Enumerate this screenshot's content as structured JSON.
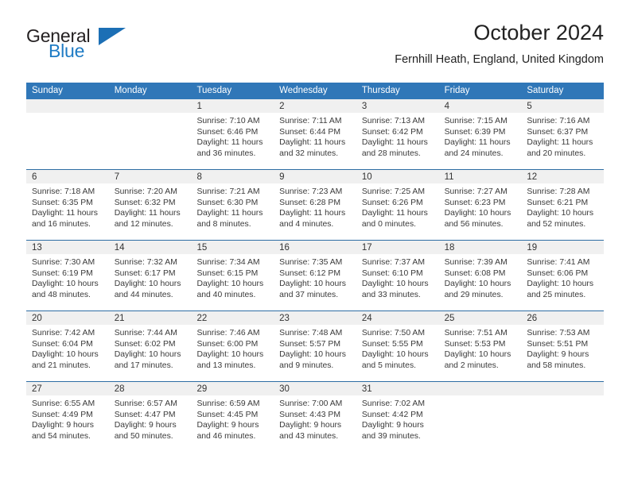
{
  "brand": {
    "name_top": "General",
    "name_bottom": "Blue",
    "triangle_color": "#1c6fb5",
    "blue_color": "#1e7bc4"
  },
  "header": {
    "title": "October 2024",
    "location": "Fernhill Heath, England, United Kingdom"
  },
  "theme": {
    "header_row_color": "#3077b8",
    "week_separator_color": "#2e6da4",
    "date_band_color": "#f0f0f0"
  },
  "weekdays": [
    "Sunday",
    "Monday",
    "Tuesday",
    "Wednesday",
    "Thursday",
    "Friday",
    "Saturday"
  ],
  "weeks": [
    [
      {
        "day": "",
        "sunrise": "",
        "sunset": "",
        "daylight1": "",
        "daylight2": "",
        "empty": true
      },
      {
        "day": "",
        "sunrise": "",
        "sunset": "",
        "daylight1": "",
        "daylight2": "",
        "empty": true
      },
      {
        "day": "1",
        "sunrise": "Sunrise: 7:10 AM",
        "sunset": "Sunset: 6:46 PM",
        "daylight1": "Daylight: 11 hours",
        "daylight2": "and 36 minutes."
      },
      {
        "day": "2",
        "sunrise": "Sunrise: 7:11 AM",
        "sunset": "Sunset: 6:44 PM",
        "daylight1": "Daylight: 11 hours",
        "daylight2": "and 32 minutes."
      },
      {
        "day": "3",
        "sunrise": "Sunrise: 7:13 AM",
        "sunset": "Sunset: 6:42 PM",
        "daylight1": "Daylight: 11 hours",
        "daylight2": "and 28 minutes."
      },
      {
        "day": "4",
        "sunrise": "Sunrise: 7:15 AM",
        "sunset": "Sunset: 6:39 PM",
        "daylight1": "Daylight: 11 hours",
        "daylight2": "and 24 minutes."
      },
      {
        "day": "5",
        "sunrise": "Sunrise: 7:16 AM",
        "sunset": "Sunset: 6:37 PM",
        "daylight1": "Daylight: 11 hours",
        "daylight2": "and 20 minutes."
      }
    ],
    [
      {
        "day": "6",
        "sunrise": "Sunrise: 7:18 AM",
        "sunset": "Sunset: 6:35 PM",
        "daylight1": "Daylight: 11 hours",
        "daylight2": "and 16 minutes."
      },
      {
        "day": "7",
        "sunrise": "Sunrise: 7:20 AM",
        "sunset": "Sunset: 6:32 PM",
        "daylight1": "Daylight: 11 hours",
        "daylight2": "and 12 minutes."
      },
      {
        "day": "8",
        "sunrise": "Sunrise: 7:21 AM",
        "sunset": "Sunset: 6:30 PM",
        "daylight1": "Daylight: 11 hours",
        "daylight2": "and 8 minutes."
      },
      {
        "day": "9",
        "sunrise": "Sunrise: 7:23 AM",
        "sunset": "Sunset: 6:28 PM",
        "daylight1": "Daylight: 11 hours",
        "daylight2": "and 4 minutes."
      },
      {
        "day": "10",
        "sunrise": "Sunrise: 7:25 AM",
        "sunset": "Sunset: 6:26 PM",
        "daylight1": "Daylight: 11 hours",
        "daylight2": "and 0 minutes."
      },
      {
        "day": "11",
        "sunrise": "Sunrise: 7:27 AM",
        "sunset": "Sunset: 6:23 PM",
        "daylight1": "Daylight: 10 hours",
        "daylight2": "and 56 minutes."
      },
      {
        "day": "12",
        "sunrise": "Sunrise: 7:28 AM",
        "sunset": "Sunset: 6:21 PM",
        "daylight1": "Daylight: 10 hours",
        "daylight2": "and 52 minutes."
      }
    ],
    [
      {
        "day": "13",
        "sunrise": "Sunrise: 7:30 AM",
        "sunset": "Sunset: 6:19 PM",
        "daylight1": "Daylight: 10 hours",
        "daylight2": "and 48 minutes."
      },
      {
        "day": "14",
        "sunrise": "Sunrise: 7:32 AM",
        "sunset": "Sunset: 6:17 PM",
        "daylight1": "Daylight: 10 hours",
        "daylight2": "and 44 minutes."
      },
      {
        "day": "15",
        "sunrise": "Sunrise: 7:34 AM",
        "sunset": "Sunset: 6:15 PM",
        "daylight1": "Daylight: 10 hours",
        "daylight2": "and 40 minutes."
      },
      {
        "day": "16",
        "sunrise": "Sunrise: 7:35 AM",
        "sunset": "Sunset: 6:12 PM",
        "daylight1": "Daylight: 10 hours",
        "daylight2": "and 37 minutes."
      },
      {
        "day": "17",
        "sunrise": "Sunrise: 7:37 AM",
        "sunset": "Sunset: 6:10 PM",
        "daylight1": "Daylight: 10 hours",
        "daylight2": "and 33 minutes."
      },
      {
        "day": "18",
        "sunrise": "Sunrise: 7:39 AM",
        "sunset": "Sunset: 6:08 PM",
        "daylight1": "Daylight: 10 hours",
        "daylight2": "and 29 minutes."
      },
      {
        "day": "19",
        "sunrise": "Sunrise: 7:41 AM",
        "sunset": "Sunset: 6:06 PM",
        "daylight1": "Daylight: 10 hours",
        "daylight2": "and 25 minutes."
      }
    ],
    [
      {
        "day": "20",
        "sunrise": "Sunrise: 7:42 AM",
        "sunset": "Sunset: 6:04 PM",
        "daylight1": "Daylight: 10 hours",
        "daylight2": "and 21 minutes."
      },
      {
        "day": "21",
        "sunrise": "Sunrise: 7:44 AM",
        "sunset": "Sunset: 6:02 PM",
        "daylight1": "Daylight: 10 hours",
        "daylight2": "and 17 minutes."
      },
      {
        "day": "22",
        "sunrise": "Sunrise: 7:46 AM",
        "sunset": "Sunset: 6:00 PM",
        "daylight1": "Daylight: 10 hours",
        "daylight2": "and 13 minutes."
      },
      {
        "day": "23",
        "sunrise": "Sunrise: 7:48 AM",
        "sunset": "Sunset: 5:57 PM",
        "daylight1": "Daylight: 10 hours",
        "daylight2": "and 9 minutes."
      },
      {
        "day": "24",
        "sunrise": "Sunrise: 7:50 AM",
        "sunset": "Sunset: 5:55 PM",
        "daylight1": "Daylight: 10 hours",
        "daylight2": "and 5 minutes."
      },
      {
        "day": "25",
        "sunrise": "Sunrise: 7:51 AM",
        "sunset": "Sunset: 5:53 PM",
        "daylight1": "Daylight: 10 hours",
        "daylight2": "and 2 minutes."
      },
      {
        "day": "26",
        "sunrise": "Sunrise: 7:53 AM",
        "sunset": "Sunset: 5:51 PM",
        "daylight1": "Daylight: 9 hours",
        "daylight2": "and 58 minutes."
      }
    ],
    [
      {
        "day": "27",
        "sunrise": "Sunrise: 6:55 AM",
        "sunset": "Sunset: 4:49 PM",
        "daylight1": "Daylight: 9 hours",
        "daylight2": "and 54 minutes."
      },
      {
        "day": "28",
        "sunrise": "Sunrise: 6:57 AM",
        "sunset": "Sunset: 4:47 PM",
        "daylight1": "Daylight: 9 hours",
        "daylight2": "and 50 minutes."
      },
      {
        "day": "29",
        "sunrise": "Sunrise: 6:59 AM",
        "sunset": "Sunset: 4:45 PM",
        "daylight1": "Daylight: 9 hours",
        "daylight2": "and 46 minutes."
      },
      {
        "day": "30",
        "sunrise": "Sunrise: 7:00 AM",
        "sunset": "Sunset: 4:43 PM",
        "daylight1": "Daylight: 9 hours",
        "daylight2": "and 43 minutes."
      },
      {
        "day": "31",
        "sunrise": "Sunrise: 7:02 AM",
        "sunset": "Sunset: 4:42 PM",
        "daylight1": "Daylight: 9 hours",
        "daylight2": "and 39 minutes."
      },
      {
        "day": "",
        "sunrise": "",
        "sunset": "",
        "daylight1": "",
        "daylight2": "",
        "empty": true
      },
      {
        "day": "",
        "sunrise": "",
        "sunset": "",
        "daylight1": "",
        "daylight2": "",
        "empty": true
      }
    ]
  ]
}
